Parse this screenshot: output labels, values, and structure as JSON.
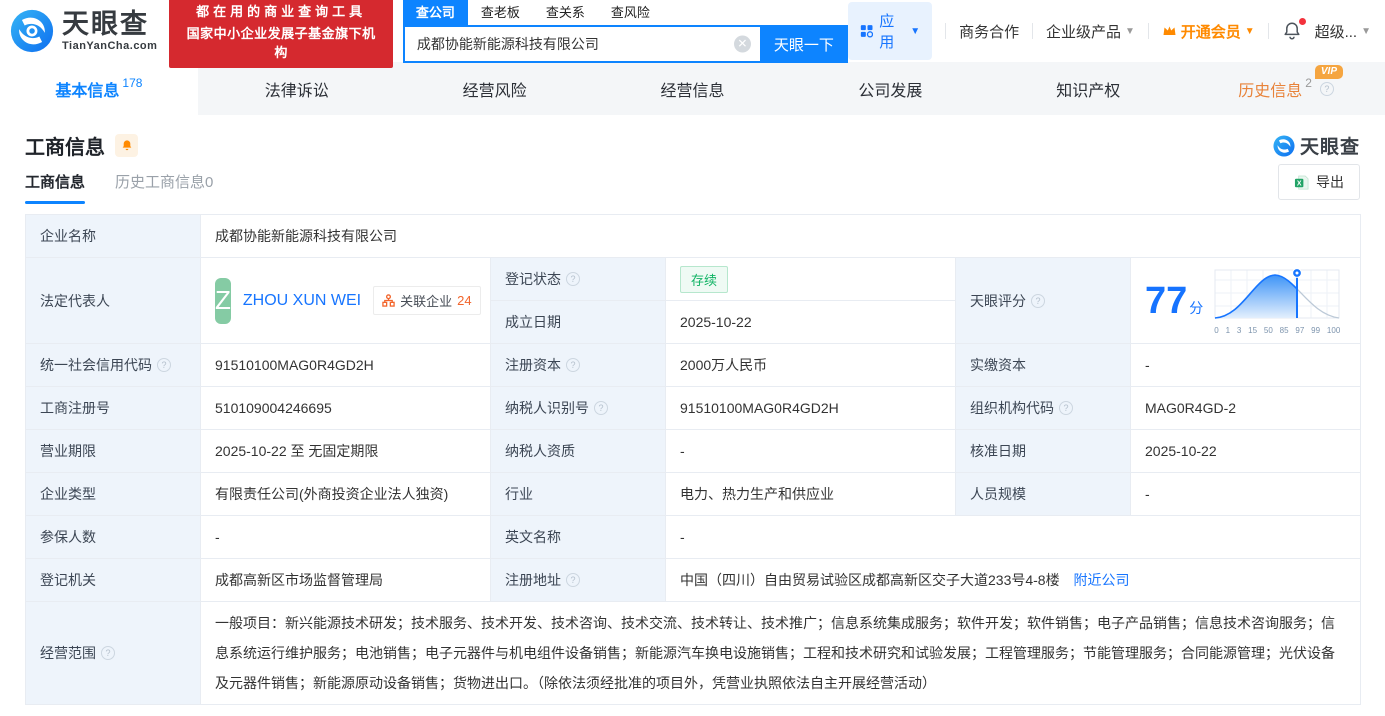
{
  "colors": {
    "accent": "#0d84ff",
    "brand_red": "#d5292f",
    "vip_orange": "#ff8a00",
    "status_green": "#10b364"
  },
  "header": {
    "logo_brand": "天眼查",
    "logo_domain": "TianYanCha.com",
    "promo_line1": "都在用的商业查询工具",
    "promo_line2": "国家中小企业发展子基金旗下机构",
    "search_tabs": [
      {
        "label": "查公司"
      },
      {
        "label": "查老板"
      },
      {
        "label": "查关系"
      },
      {
        "label": "查风险"
      }
    ],
    "search_value": "成都协能新能源科技有限公司",
    "search_button": "天眼一下",
    "nav_apps": "应用",
    "nav_coop": "商务合作",
    "nav_enterprise": "企业级产品",
    "nav_vip": "开通会员",
    "nav_super": "超级..."
  },
  "tabs": [
    {
      "label": "基本信息",
      "count": "178"
    },
    {
      "label": "法律诉讼"
    },
    {
      "label": "经营风险"
    },
    {
      "label": "经营信息"
    },
    {
      "label": "公司发展"
    },
    {
      "label": "知识产权"
    },
    {
      "label": "历史信息",
      "count": "2",
      "badge": "VIP"
    }
  ],
  "section": {
    "title": "工商信息",
    "watermark": "天眼查",
    "subtab_active": "工商信息",
    "subtab_history": "历史工商信息0",
    "export_label": "导出"
  },
  "fields": {
    "company_name": {
      "label": "企业名称",
      "value": "成都协能新能源科技有限公司"
    },
    "legal_rep": {
      "label": "法定代表人",
      "avatar": "Z",
      "name": "ZHOU XUN WEI",
      "related_label": "关联企业",
      "related_count": "24"
    },
    "reg_status": {
      "label": "登记状态",
      "value": "存续"
    },
    "establish_date": {
      "label": "成立日期",
      "value": "2025-10-22"
    },
    "score": {
      "label": "天眼评分",
      "value": "77",
      "unit": "分"
    },
    "credit_code": {
      "label": "统一社会信用代码",
      "value": "91510100MAG0R4GD2H"
    },
    "reg_capital": {
      "label": "注册资本",
      "value": "2000万人民币"
    },
    "paid_capital": {
      "label": "实缴资本",
      "value": "-"
    },
    "reg_number": {
      "label": "工商注册号",
      "value": "510109004246695"
    },
    "taxpayer_id": {
      "label": "纳税人识别号",
      "value": "91510100MAG0R4GD2H"
    },
    "org_code": {
      "label": "组织机构代码",
      "value": "MAG0R4GD-2"
    },
    "business_term": {
      "label": "营业期限",
      "value": "2025-10-22 至 无固定期限"
    },
    "taxpayer_quality": {
      "label": "纳税人资质",
      "value": "-"
    },
    "approval_date": {
      "label": "核准日期",
      "value": "2025-10-22"
    },
    "company_type": {
      "label": "企业类型",
      "value": "有限责任公司(外商投资企业法人独资)"
    },
    "industry": {
      "label": "行业",
      "value": "电力、热力生产和供应业"
    },
    "staff_size": {
      "label": "人员规模",
      "value": "-"
    },
    "insured_count": {
      "label": "参保人数",
      "value": "-"
    },
    "english_name": {
      "label": "英文名称",
      "value": "-"
    },
    "reg_authority": {
      "label": "登记机关",
      "value": "成都高新区市场监督管理局"
    },
    "reg_address": {
      "label": "注册地址",
      "value": "中国（四川）自由贸易试验区成都高新区交子大道233号4-8楼",
      "link": "附近公司"
    },
    "business_scope": {
      "label": "经营范围",
      "value": "一般项目：新兴能源技术研发；技术服务、技术开发、技术咨询、技术交流、技术转让、技术推广；信息系统集成服务；软件开发；软件销售；电子产品销售；信息技术咨询服务；信息系统运行维护服务；电池销售；电子元器件与机电组件设备销售；新能源汽车换电设施销售；工程和技术研究和试验发展；工程管理服务；节能管理服务；合同能源管理；光伏设备及元器件销售；新能源原动设备销售；货物进出口。（除依法须经批准的项目外，凭营业执照依法自主开展经营活动）"
    }
  },
  "score_chart": {
    "type": "area",
    "score": 77,
    "x_ticks": [
      "0",
      "1",
      "3",
      "15",
      "50",
      "85",
      "97",
      "99",
      "100"
    ],
    "marker_value": 77
  }
}
